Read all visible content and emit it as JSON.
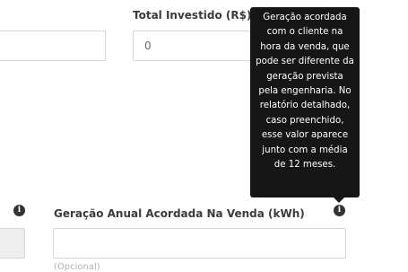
{
  "fields": {
    "total_investido": {
      "label": "Total Investido (R$)",
      "value": "0"
    },
    "geracao_anual": {
      "label": "Geração Anual Acordada Na Venda (kWh)",
      "value": "",
      "hint": "(Opcional)"
    }
  },
  "icons": {
    "info_left": "i",
    "info_right": "i"
  },
  "tooltip": {
    "text": "Geração acordada com o cliente na hora da venda, que pode ser diferente da geração prevista pela engenharia. No relatório detalhado, caso preenchido, esse valor aparece junto com a média de 12 meses."
  }
}
